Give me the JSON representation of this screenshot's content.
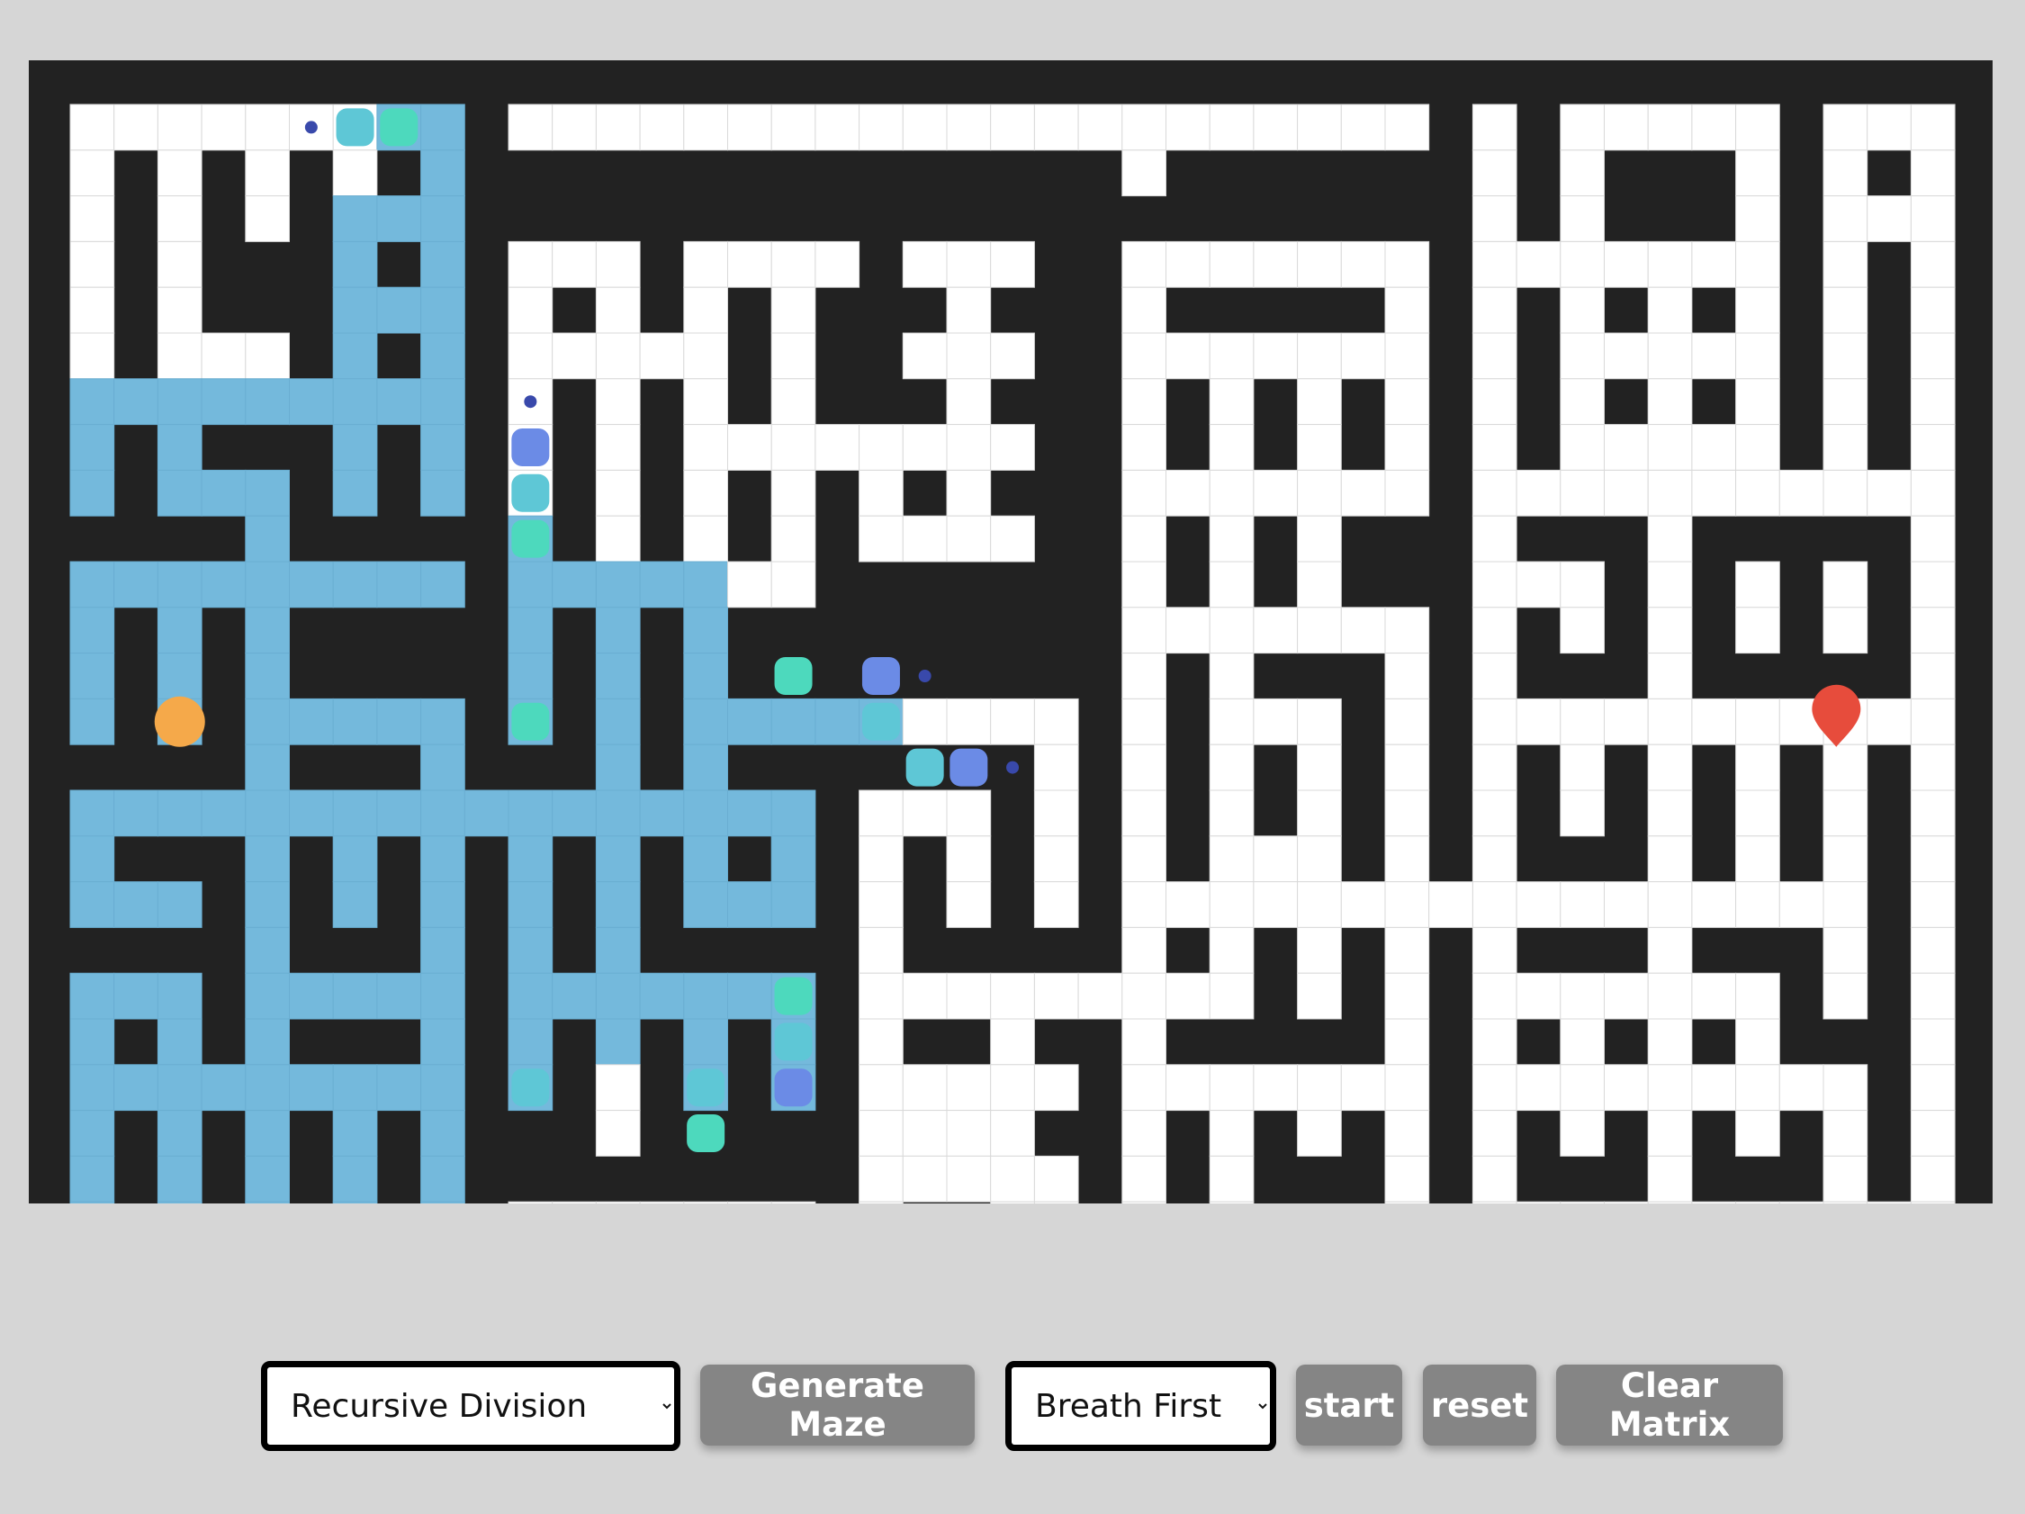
{
  "app": {
    "maze": {
      "cols": 43,
      "rows": 25,
      "start": {
        "row": 13,
        "col": 2
      },
      "target": {
        "row": 13,
        "col": 40
      }
    },
    "colors": {
      "background": "#d6d6d6",
      "wall": "#222222",
      "open": "#ffffff",
      "visited": "#74b9dc",
      "frontier": "#4dd9bd",
      "frontier_alt": "#5ec7d6",
      "frontier_new": "#6b8be6",
      "start_node": "#f5a94a",
      "target_node": "#e74c3c"
    },
    "icons": {
      "start": "circle-icon",
      "target": "map-pin-icon"
    },
    "controls": {
      "maze_algorithm": {
        "selected": "Recursive Division"
      },
      "generate_label": "Generate Maze",
      "search_algorithm": {
        "selected": "Breath First"
      },
      "start_label": "start",
      "reset_label": "reset",
      "clear_label": "Clear Matrix"
    }
  }
}
